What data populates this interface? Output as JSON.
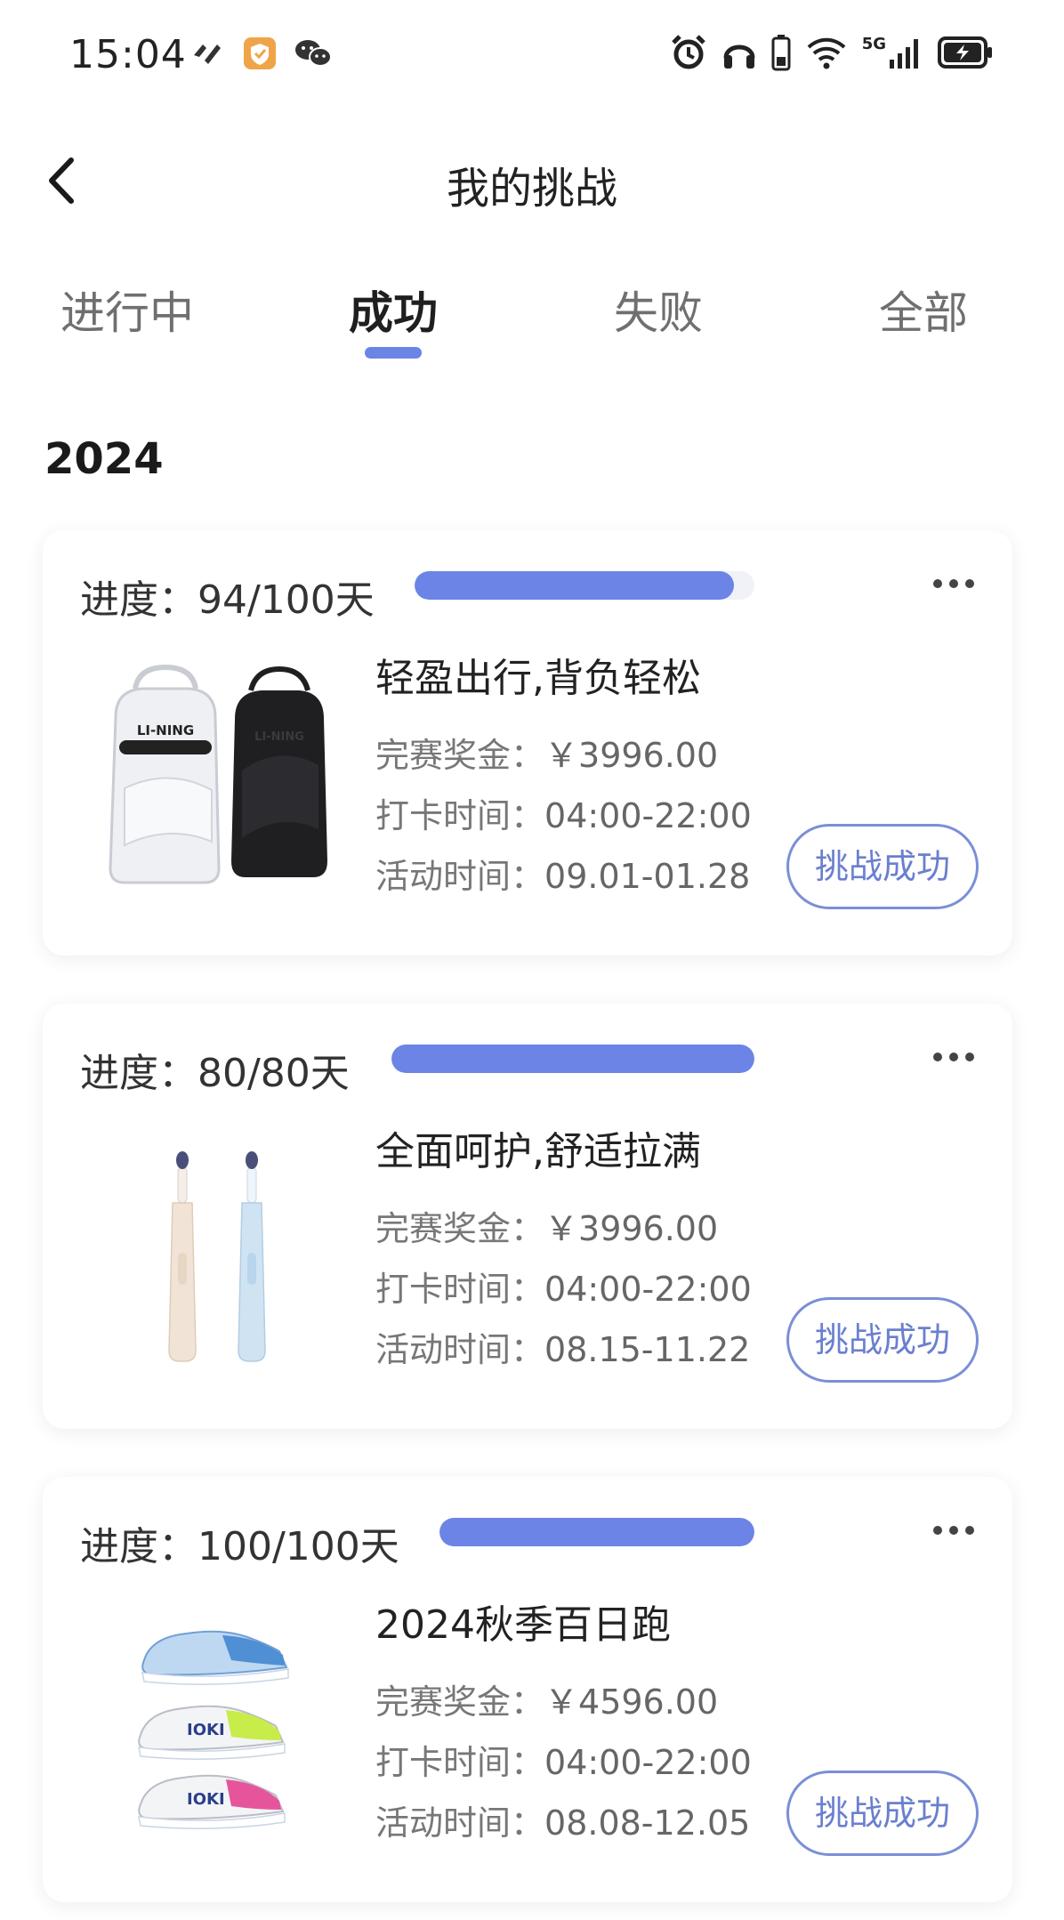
{
  "status_bar": {
    "time": "15:04",
    "network": "5G",
    "icons_left": [
      "app-icon",
      "shield-heart-icon",
      "wechat-icon"
    ],
    "icons_right": [
      "alarm-icon",
      "headphones-icon",
      "battery-small-icon",
      "wifi-icon",
      "signal-icon",
      "battery-charging-icon"
    ]
  },
  "header": {
    "title": "我的挑战"
  },
  "tabs": [
    {
      "label": "进行中",
      "active": false
    },
    {
      "label": "成功",
      "active": true
    },
    {
      "label": "失败",
      "active": false
    },
    {
      "label": "全部",
      "active": false
    }
  ],
  "section": {
    "year": "2024"
  },
  "colors": {
    "accent": "#6b84e6",
    "button_border": "#7a8fd6"
  },
  "challenges": [
    {
      "progress_label": "进度：94/100天",
      "progress_fraction": 0.94,
      "title": "轻盈出行,背负轻松",
      "prize_label": "完赛奖金：",
      "prize_value": "￥3996.00",
      "checkin_label": "打卡时间：",
      "checkin_value": "04:00-22:00",
      "activity_label": "活动时间：",
      "activity_value": "09.01-01.28",
      "status_button": "挑战成功",
      "image": "backpack-image",
      "brand": "LI-NING"
    },
    {
      "progress_label": "进度：80/80天",
      "progress_fraction": 1.0,
      "title": "全面呵护,舒适拉满",
      "prize_label": "完赛奖金：",
      "prize_value": "￥3996.00",
      "checkin_label": "打卡时间：",
      "checkin_value": "04:00-22:00",
      "activity_label": "活动时间：",
      "activity_value": "08.15-11.22",
      "status_button": "挑战成功",
      "image": "toothbrush-image"
    },
    {
      "progress_label": "进度：100/100天",
      "progress_fraction": 1.0,
      "title": "2024秋季百日跑",
      "prize_label": "完赛奖金：",
      "prize_value": "￥4596.00",
      "checkin_label": "打卡时间：",
      "checkin_value": "04:00-22:00",
      "activity_label": "活动时间：",
      "activity_value": "08.08-12.05",
      "status_button": "挑战成功",
      "image": "running-shoes-image"
    }
  ]
}
